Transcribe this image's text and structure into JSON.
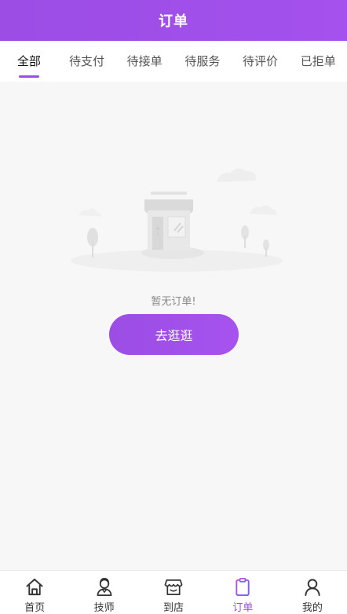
{
  "header": {
    "title": "订单"
  },
  "tabs": [
    {
      "label": "全部",
      "active": true
    },
    {
      "label": "待支付"
    },
    {
      "label": "待接单"
    },
    {
      "label": "待服务"
    },
    {
      "label": "待评价"
    },
    {
      "label": "已拒单"
    }
  ],
  "empty_state": {
    "illustration_icon": "empty-store-icon",
    "message": "暂无订单!",
    "button_label": "去逛逛"
  },
  "tabbar": [
    {
      "label": "首页",
      "icon": "home-icon"
    },
    {
      "label": "技师",
      "icon": "technician-icon"
    },
    {
      "label": "到店",
      "icon": "store-icon"
    },
    {
      "label": "订单",
      "icon": "order-icon",
      "active": true
    },
    {
      "label": "我的",
      "icon": "profile-icon"
    }
  ],
  "colors": {
    "accent": "#9b4de4",
    "background": "#f7f7f7",
    "text_muted": "#888888"
  }
}
